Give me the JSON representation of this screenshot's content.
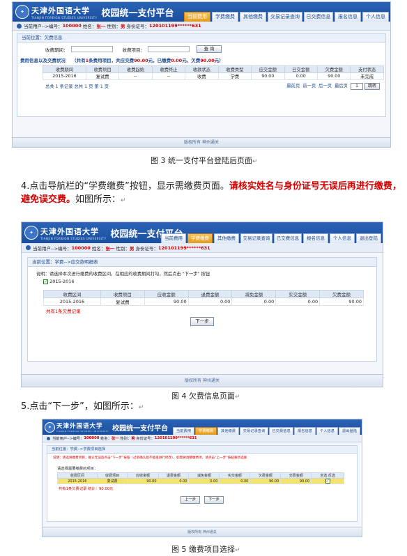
{
  "header": {
    "university_cn": "天津外国语大学",
    "university_en": "TIANJIN FOREIGN STUDIES UNIVERSITY",
    "platform": "校园统一支付平台",
    "nav_tabs": [
      "当前费用",
      "学费缴费",
      "其他缴费",
      "交易记录查询",
      "已交费信息",
      "报名信息",
      "个人信息",
      "退出登陆"
    ]
  },
  "userbar": {
    "label_user": "当前用户-->编号：",
    "user_id": "100000",
    "label_name": "姓名：",
    "name": "张一",
    "label_gender": "性别：",
    "gender": "男",
    "label_idcard": "身份证号：",
    "idcard": "120101199******631"
  },
  "shot1": {
    "crumb": "当前位置：欠费信息",
    "q_period_label": "收费期间：",
    "q_item_label": "收费项目：",
    "query_btn": "查 询",
    "summary_label": "费用信息以及交费状况",
    "summary_pre": "（共有",
    "summary_count": "1",
    "summary_mid": "条费用项目，共应交费",
    "summary_due": "90.00",
    "summary_mid2": "元，已缴费",
    "summary_paid": "0.00",
    "summary_mid3": "元，欠费",
    "summary_owe": "90.00",
    "summary_end": "元）",
    "columns": [
      "收费期间",
      "收费项目",
      "收费起始",
      "收费终止",
      "收款状态",
      "收费类型",
      "应交金额",
      "已交金额",
      "欠费金额",
      "支付状态"
    ],
    "rows": [
      [
        "2015-2016",
        "复试费",
        "--",
        "--",
        "收费",
        "学费",
        "90.00",
        "0.00",
        "90.00",
        "未完成"
      ]
    ],
    "pager_left": "总共 1 条记录    总共 1 页    第 1 页",
    "pager_links": [
      "最前页",
      "前一页",
      "后一页",
      "最后页"
    ],
    "page_input": "1",
    "jump_btn": "跳转"
  },
  "footer": "版权所有 神州通关",
  "caption1": "图 3  统一支付平台登陆后页面",
  "para4": {
    "text": "4.点击导航栏的“学费缴费”按钮，显示需缴费页面。",
    "red": "请核实姓名与身份证号无误后再进行缴费，避免误交费。",
    "tail": "如图所示："
  },
  "shot2": {
    "crumb": "当前位置：学费-->应交款明细表",
    "note": "说明：请选择本次进行缴费的收费区间，在相应的收费期间打勾，然后点击 \"下一步\" 按钮",
    "period_option": "2015-2016",
    "columns": [
      "收费区间",
      "收费项目",
      "应收金额",
      "退费金额",
      "减免金额",
      "实交金额",
      "欠费金额"
    ],
    "rows": [
      [
        "2015-2016",
        "复试费",
        "90.00",
        "0.00",
        "0.00",
        "0.00",
        "90.00"
      ]
    ],
    "owe_note": "共有1条欠费记录",
    "next_btn": "下一步"
  },
  "caption2": "图 4  欠费信息页面",
  "para5": {
    "text": "5.点击“下一步”，如图所示："
  },
  "shot3": {
    "crumb": "当前位置：学费-->学费项目选择",
    "note": "说明：请选择缴费项目，确认无误后点击“下一步”按钮（过单确认后不能再进行修改），如需要调整缴费项，请点击“上一步”按钮重新选择",
    "section": "请选择需要缴费的项目：",
    "columns": [
      "收费区间",
      "收费项目",
      "应收金额",
      "退费金额",
      "减免金额",
      "实交金额",
      "欠费金额",
      "交费金额",
      "全选 反选"
    ],
    "rows": [
      [
        "2015-2016",
        "复试费",
        "90.00",
        "0.00",
        "0.00",
        "0.00",
        "90.00",
        "90.00",
        "✓"
      ]
    ],
    "owe_note": "共有1条欠费记录  统计：90.00元",
    "prev_btn": "上一步",
    "next_btn": "下一步"
  },
  "caption3": "图 5  缴费项目选择",
  "colors": {
    "brand_blue": "#1b4f9e",
    "accent_orange": "#e39b1b",
    "warn_red": "#d10000"
  }
}
